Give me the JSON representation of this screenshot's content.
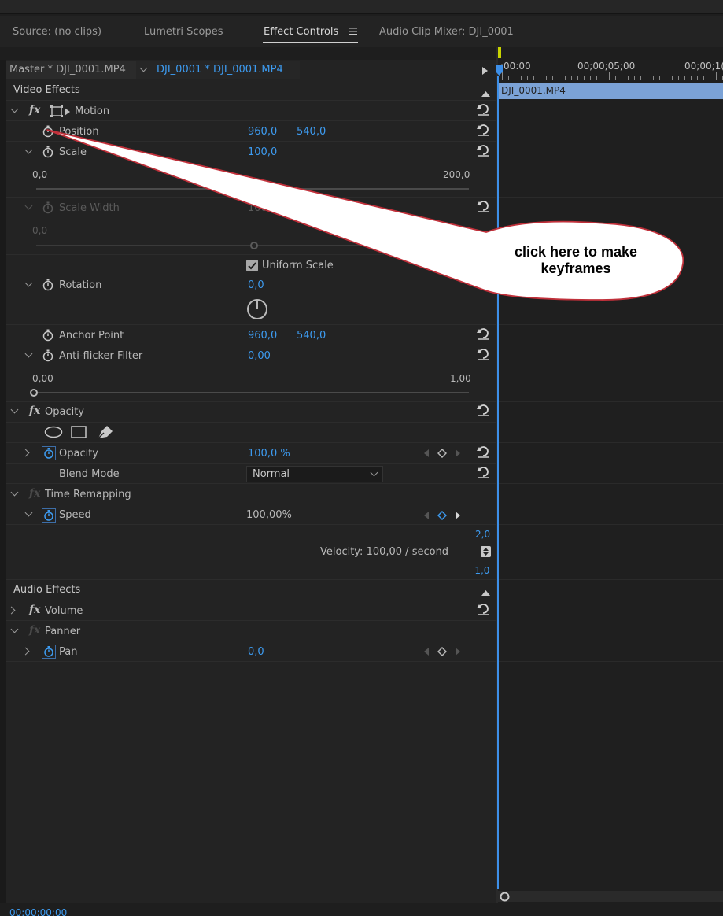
{
  "tabs": [
    {
      "label": "Source: (no clips)"
    },
    {
      "label": "Lumetri Scopes"
    },
    {
      "label": "Effect Controls"
    },
    {
      "label": "Audio Clip Mixer: DJI_0001"
    }
  ],
  "clip_header": {
    "master": "Master * DJI_0001.MP4",
    "clip": "DJI_0001 * DJI_0001.MP4"
  },
  "timeline": {
    "time_start": ":00:00",
    "time_mid": "00;00;05;00",
    "time_end": "00;00;1(",
    "clip_name": "DJI_0001.MP4",
    "current_time": "00:00:00:00"
  },
  "video_effects": {
    "header": "Video Effects",
    "motion": {
      "label": "Motion",
      "position": {
        "label": "Position",
        "x": "960,0",
        "y": "540,0"
      },
      "scale": {
        "label": "Scale",
        "value": "100,0",
        "min": "0,0",
        "max": "200,0"
      },
      "scale_width": {
        "label": "Scale Width",
        "value": "100,0",
        "min": "0,0",
        "max": "200,0"
      },
      "uniform_scale": "Uniform Scale",
      "rotation": {
        "label": "Rotation",
        "value": "0,0"
      },
      "anchor_point": {
        "label": "Anchor Point",
        "x": "960,0",
        "y": "540,0"
      },
      "anti_flicker": {
        "label": "Anti-flicker Filter",
        "value": "0,00",
        "min": "0,00",
        "max": "1,00"
      }
    },
    "opacity": {
      "label": "Opacity",
      "opacity_prop": {
        "label": "Opacity",
        "value": "100,0 %"
      },
      "blend_mode": {
        "label": "Blend Mode",
        "value": "Normal"
      }
    },
    "time_remapping": {
      "label": "Time Remapping",
      "speed": {
        "label": "Speed",
        "value": "100,00%"
      },
      "graph_max": "2,0",
      "velocity": "Velocity: 100,00 / second",
      "graph_min": "-1,0"
    }
  },
  "audio_effects": {
    "header": "Audio Effects",
    "volume": "Volume",
    "panner": "Panner",
    "pan": {
      "label": "Pan",
      "value": "0,0"
    }
  },
  "callout": {
    "text": "click here to make keyframes"
  },
  "colors": {
    "accent_blue": "#3d9bf0",
    "clip_bar": "#7ba2d6",
    "callout_border": "#c0303a"
  }
}
